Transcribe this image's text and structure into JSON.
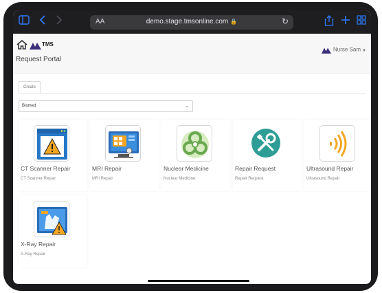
{
  "browser": {
    "aa_label": "AA",
    "url": "demo.stage.tmsonline.com",
    "icons": [
      "sidebar-icon",
      "back-icon",
      "forward-icon",
      "lock-icon",
      "reload-icon",
      "share-icon",
      "new-tab-icon",
      "tabs-icon"
    ]
  },
  "header": {
    "brand": "TMS",
    "portal_title": "Request Portal",
    "user_name": "Nurse Sam"
  },
  "tabs": [
    {
      "label": "Create"
    }
  ],
  "department_select": {
    "value": "Biomed"
  },
  "cards": [
    {
      "name": "CT Scanner Repair",
      "sub": "CT Scanner Repair",
      "icon": "warning-monitor-icon"
    },
    {
      "name": "MRI Repair",
      "sub": "MRI Repair",
      "icon": "mri-monitor-icon"
    },
    {
      "name": "Nuclear Medicine",
      "sub": "Nuclear Medicine",
      "icon": "biohazard-icon"
    },
    {
      "name": "Repair Request",
      "sub": "Repair Request",
      "icon": "tools-icon"
    },
    {
      "name": "Ultrasound Repair",
      "sub": "Ultrasound Repair",
      "icon": "ultrasound-waves-icon"
    },
    {
      "name": "X-Ray Repair",
      "sub": "X-Ray Repair",
      "icon": "xray-warning-icon"
    }
  ],
  "colors": {
    "accent_blue": "#2f7bff",
    "brand_purple": "#3b2d7a",
    "teal": "#2e9d96",
    "orange": "#f5a623"
  }
}
